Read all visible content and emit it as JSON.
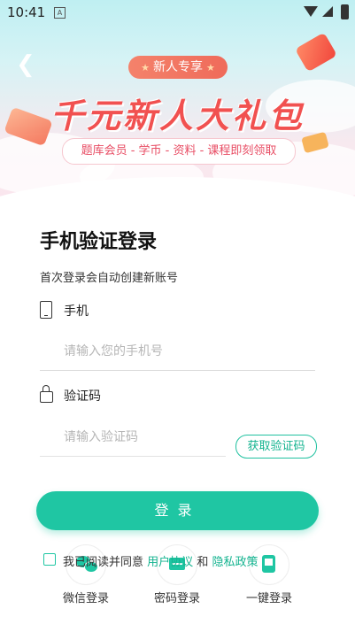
{
  "status_bar": {
    "time": "10:41",
    "sim_badge": "A"
  },
  "banner": {
    "back_icon": "back-arrow-icon",
    "badge": "新人专享",
    "headline": "千元新人大礼包",
    "tagline": "题库会员 - 学币 - 资料 - 课程即刻领取"
  },
  "form": {
    "title": "手机验证登录",
    "subtitle": "首次登录会自动创建新账号",
    "phone_label": "手机",
    "phone_placeholder": "请输入您的手机号",
    "code_label": "验证码",
    "code_placeholder": "请输入验证码",
    "get_code_label": "获取验证码",
    "login_label": "登录"
  },
  "agreement": {
    "prefix": "我已阅读并同意",
    "user_agreement": "用户协议",
    "and": "和",
    "privacy_policy": "隐私政策"
  },
  "alt_login": [
    {
      "label": "微信登录",
      "icon": "wechat-icon"
    },
    {
      "label": "密码登录",
      "icon": "password-icon"
    },
    {
      "label": "一键登录",
      "icon": "one-tap-icon"
    }
  ],
  "colors": {
    "accent": "#1fc6a3",
    "headline": "#f15150",
    "badge": "#ef6b5a"
  }
}
